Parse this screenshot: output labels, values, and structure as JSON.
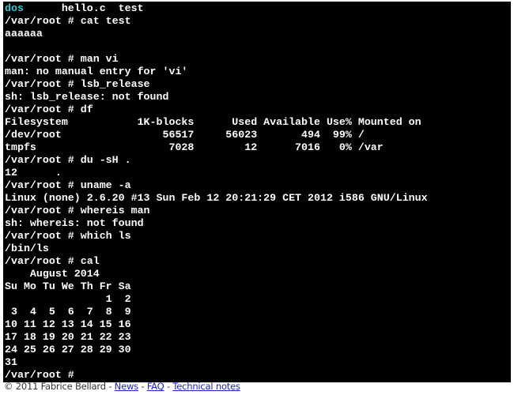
{
  "terminal": {
    "first_line": {
      "dir": "dos",
      "rest": "      hello.c  test"
    },
    "lines": [
      "/var/root # cat test",
      "aaaaaa",
      "",
      "/var/root # man vi",
      "man: no manual entry for 'vi'",
      "/var/root # lsb_release",
      "sh: lsb_release: not found",
      "/var/root # df",
      "Filesystem           1K-blocks      Used Available Use% Mounted on",
      "/dev/root                56517     56023       494  99% /",
      "tmpfs                     7028        12      7016   0% /var",
      "/var/root # du -sH .",
      "12      .",
      "/var/root # uname -a",
      "Linux (none) 2.6.20 #13 Sun Feb 12 20:21:29 CET 2012 i586 GNU/Linux",
      "/var/root # whereis man",
      "sh: whereis: not found",
      "/var/root # which ls",
      "/bin/ls",
      "/var/root # cal",
      "    August 2014",
      "Su Mo Tu We Th Fr Sa",
      "                1  2",
      " 3  4  5  6  7  8  9",
      "10 11 12 13 14 15 16",
      "17 18 19 20 21 22 23",
      "24 25 26 27 28 29 30",
      "31",
      "/var/root # "
    ],
    "colors": {
      "background": "#000000",
      "text": "#ffffff",
      "directory": "#2fc8d0"
    }
  },
  "footer": {
    "copyright": "© 2011 Fabrice Bellard",
    "sep": " - ",
    "links": [
      "News",
      "FAQ",
      "Technical notes"
    ]
  }
}
